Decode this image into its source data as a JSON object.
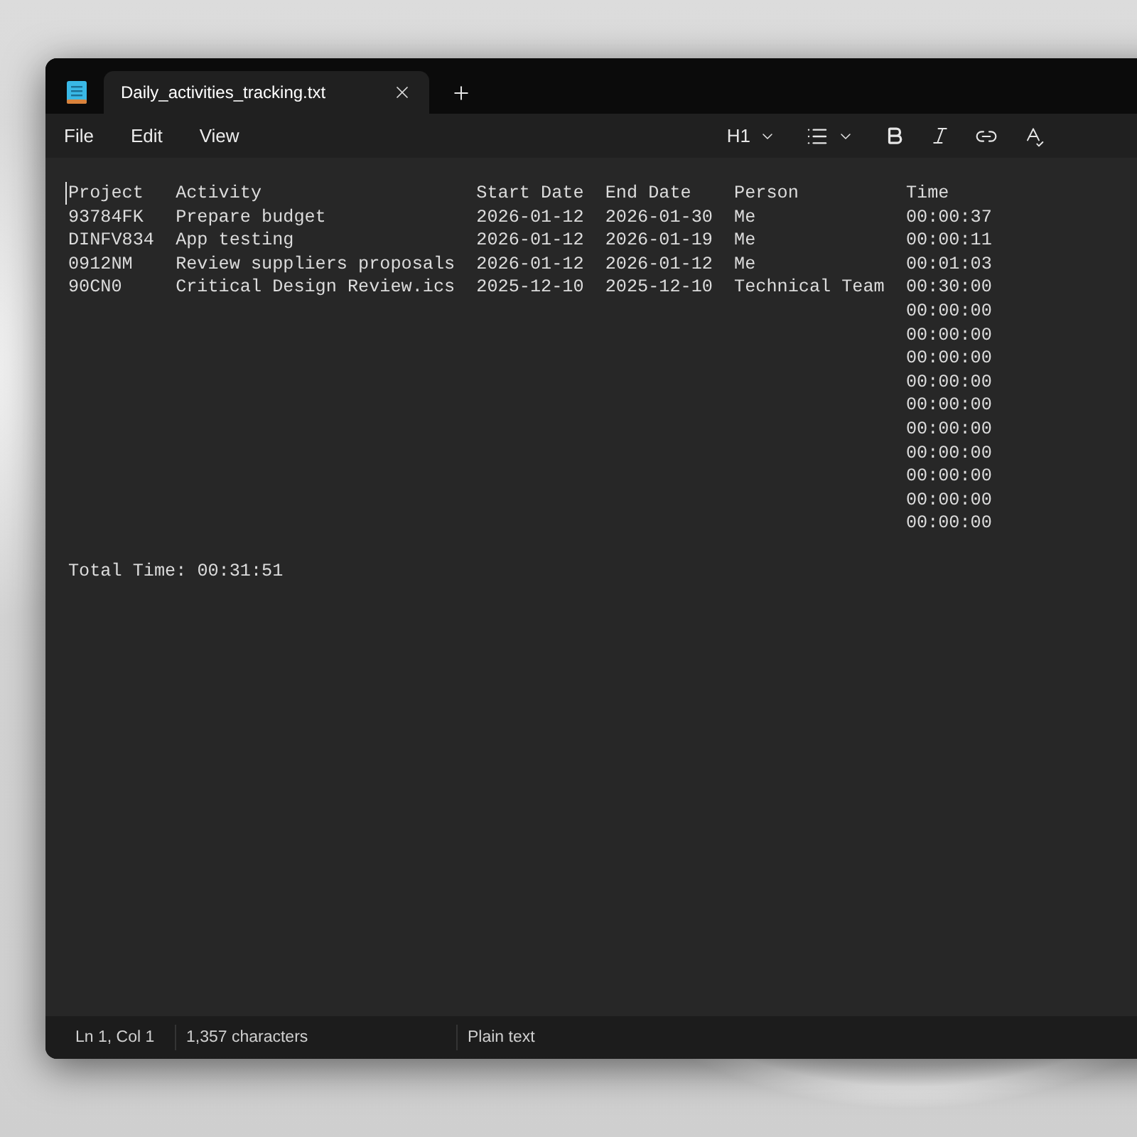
{
  "window": {
    "tabs": [
      {
        "label": "Daily_activities_tracking.txt",
        "selected": true
      }
    ]
  },
  "menu": [
    "File",
    "Edit",
    "View"
  ],
  "toolbar": {
    "heading": "H1"
  },
  "document": {
    "columns": [
      "Project",
      "Activity",
      "Start Date",
      "End Date",
      "Person",
      "Time"
    ],
    "rows": [
      {
        "project": "93784FK",
        "activity": "Prepare budget",
        "start_date": "2026-01-12",
        "end_date": "2026-01-30",
        "person": "Me",
        "time": "00:00:37"
      },
      {
        "project": "DINFV834",
        "activity": "App testing",
        "start_date": "2026-01-12",
        "end_date": "2026-01-19",
        "person": "Me",
        "time": "00:00:11"
      },
      {
        "project": "0912NM",
        "activity": "Review suppliers proposals",
        "start_date": "2026-01-12",
        "end_date": "2026-01-12",
        "person": "Me",
        "time": "00:01:03"
      },
      {
        "project": "90CN0",
        "activity": "Critical Design Review.ics",
        "start_date": "2025-12-10",
        "end_date": "2025-12-10",
        "person": "Technical Team",
        "time": "00:30:00"
      },
      {
        "time": "00:00:00"
      },
      {
        "time": "00:00:00"
      },
      {
        "time": "00:00:00"
      },
      {
        "time": "00:00:00"
      },
      {
        "time": "00:00:00"
      },
      {
        "time": "00:00:00"
      },
      {
        "time": "00:00:00"
      },
      {
        "time": "00:00:00"
      },
      {
        "time": "00:00:00"
      },
      {
        "time": "00:00:00"
      }
    ],
    "total": "Total Time: 00:31:51"
  },
  "status_bar": {
    "position": "Ln 1, Col 1",
    "characters": "1,357 characters",
    "format": "Plain text"
  }
}
